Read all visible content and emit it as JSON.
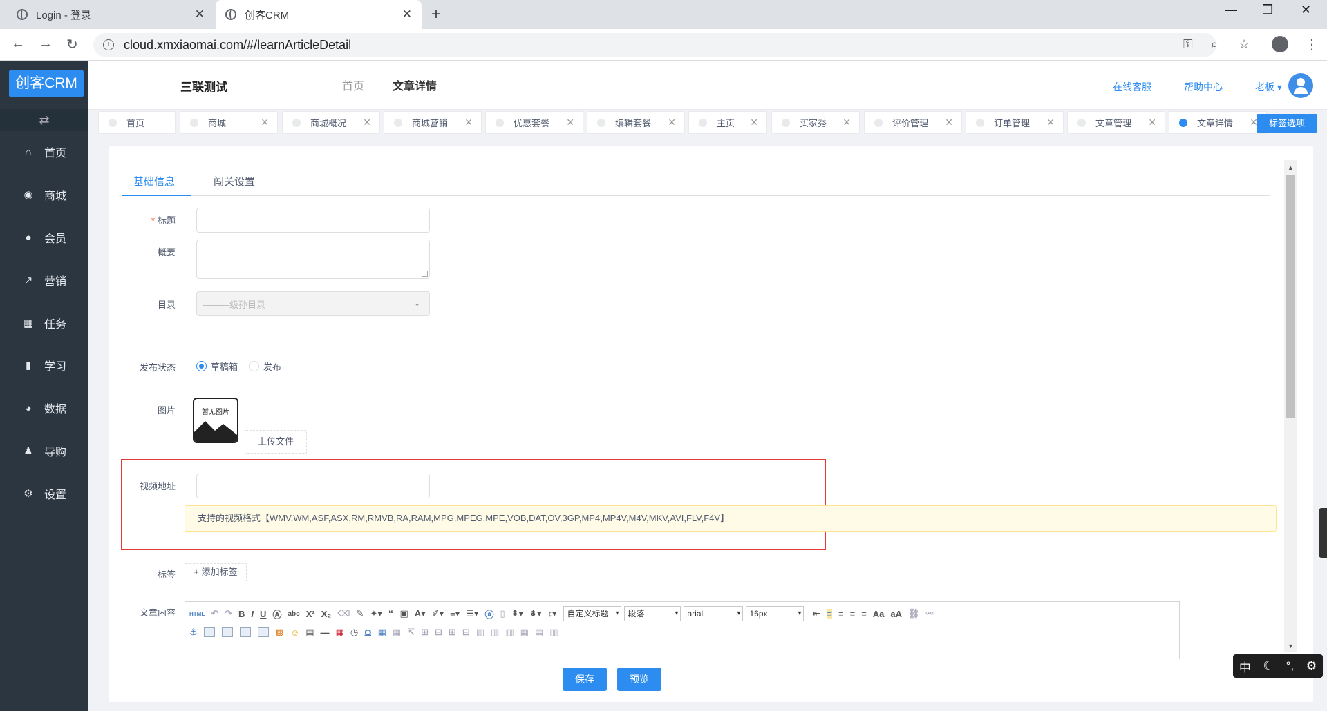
{
  "browser": {
    "tabs": [
      {
        "title": "Login - 登录",
        "active": false
      },
      {
        "title": "创客CRM",
        "active": true
      }
    ],
    "url": "cloud.xmxiaomai.com/#/learnArticleDetail"
  },
  "sidebar": {
    "brand": "创客CRM",
    "toggle_icon": "⇄",
    "items": [
      {
        "label": "首页",
        "icon": "home-icon",
        "glyph": "⌂"
      },
      {
        "label": "商城",
        "icon": "shop-icon",
        "glyph": "◉"
      },
      {
        "label": "会员",
        "icon": "user-icon",
        "glyph": "●"
      },
      {
        "label": "营销",
        "icon": "trend-icon",
        "glyph": "↗"
      },
      {
        "label": "任务",
        "icon": "grid-icon",
        "glyph": "▦"
      },
      {
        "label": "学习",
        "icon": "book-icon",
        "glyph": "▮"
      },
      {
        "label": "数据",
        "icon": "pie-icon",
        "glyph": "◕"
      },
      {
        "label": "导购",
        "icon": "group-icon",
        "glyph": "♟"
      },
      {
        "label": "设置",
        "icon": "gear-icon",
        "glyph": "⚙"
      }
    ]
  },
  "header": {
    "company": "三联测试",
    "breadcrumb_home": "首页",
    "breadcrumb_current": "文章详情",
    "links": [
      "在线客服",
      "帮助中心",
      "老板"
    ]
  },
  "tagbar": {
    "tags": [
      "首页",
      "商城",
      "商城概况",
      "商城营销",
      "优惠套餐",
      "编辑套餐",
      "主页",
      "买家秀",
      "评价管理",
      "订单管理",
      "文章管理",
      "文章详情"
    ],
    "options_label": "标签选项"
  },
  "form": {
    "tabs": [
      "基础信息",
      "闯关设置"
    ],
    "labels": {
      "title": "标题",
      "summary": "概要",
      "catalog": "目录",
      "status": "发布状态",
      "image": "图片",
      "video": "视频地址",
      "tags": "标签",
      "content": "文章内容"
    },
    "title_value": "",
    "summary_value": "",
    "catalog_placeholder": "———级孙目录",
    "status_options": [
      "草稿箱",
      "发布"
    ],
    "status_selected": "草稿箱",
    "no_image": "暂无图片",
    "upload_label": "上传文件",
    "video_value": "",
    "video_tip": "支持的视频格式【WMV,WM,ASF,ASX,RM,RMVB,RA,RAM,MPG,MPEG,MPE,VOB,DAT,OV,3GP,MP4,MP4V,M4V,MKV,AVI,FLV,F4V】",
    "add_tag_label": "+ 添加标签"
  },
  "editor": {
    "selects": [
      "自定义标题",
      "段落",
      "arial",
      "16px"
    ],
    "html_label": "HTML"
  },
  "actions": {
    "save": "保存",
    "preview": "预览"
  },
  "ime": {
    "mode": "中"
  },
  "colors": {
    "primary": "#2d8cf0",
    "sidebar_bg": "#2b3640",
    "highlight_box": "#e53935"
  }
}
